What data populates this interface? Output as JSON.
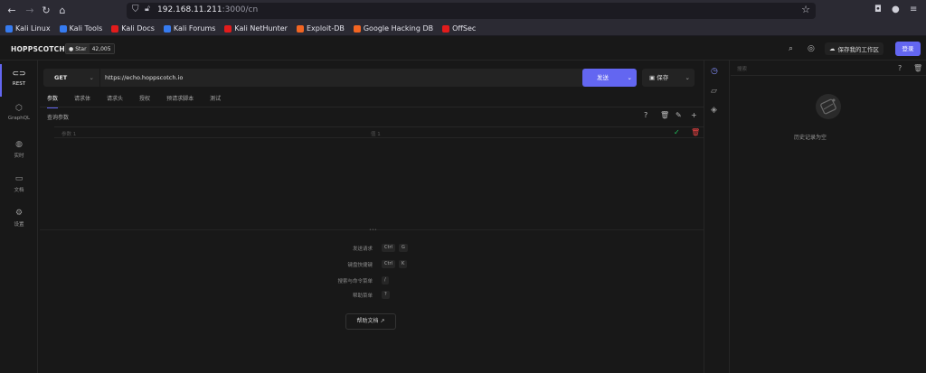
{
  "browser": {
    "url_host": "192.168.11.211",
    "url_rest": ":3000/cn",
    "bookmarks": [
      {
        "label": "Kali Linux",
        "color": "#367bf0"
      },
      {
        "label": "Kali Tools",
        "color": "#367bf0"
      },
      {
        "label": "Kali Docs",
        "color": "#e21c1c"
      },
      {
        "label": "Kali Forums",
        "color": "#367bf0"
      },
      {
        "label": "Kali NetHunter",
        "color": "#e21c1c"
      },
      {
        "label": "Exploit-DB",
        "color": "#f26522"
      },
      {
        "label": "Google Hacking DB",
        "color": "#f26522"
      },
      {
        "label": "OffSec",
        "color": "#e21c1c"
      }
    ]
  },
  "header": {
    "brand": "HOPPSCOTCH",
    "github_star": "Star",
    "github_count": "42,005",
    "save_workspace": "保存我的工作区",
    "login": "登录"
  },
  "sidebar": {
    "items": [
      {
        "label": "REST",
        "icon": "link-icon"
      },
      {
        "label": "GraphQL",
        "icon": "graphql-icon"
      },
      {
        "label": "实时",
        "icon": "globe-icon"
      },
      {
        "label": "文档",
        "icon": "book-icon"
      },
      {
        "label": "设置",
        "icon": "gear-icon"
      }
    ]
  },
  "request": {
    "method": "GET",
    "url": "https://echo.hoppscotch.io",
    "send": "发送",
    "save": "保存"
  },
  "tabs": [
    "参数",
    "请求体",
    "请求头",
    "授权",
    "预请求脚本",
    "测试"
  ],
  "params": {
    "title": "查询参数",
    "key_placeholder": "参数 1",
    "value_placeholder": "值 1"
  },
  "shortcuts": [
    {
      "label": "发送请求",
      "keys": [
        "Ctrl",
        "G"
      ]
    },
    {
      "label": "键盘快捷键",
      "keys": [
        "Ctrl",
        "K"
      ]
    },
    {
      "label": "搜索与命令菜单",
      "keys": [
        "/"
      ]
    },
    {
      "label": "帮助菜单",
      "keys": [
        "?"
      ]
    }
  ],
  "help_docs": "帮助文档",
  "history": {
    "search_placeholder": "搜索",
    "empty": "历史记录为空"
  },
  "colors": {
    "accent": "#6366f1",
    "success": "#22c55e",
    "danger": "#ef4444"
  }
}
